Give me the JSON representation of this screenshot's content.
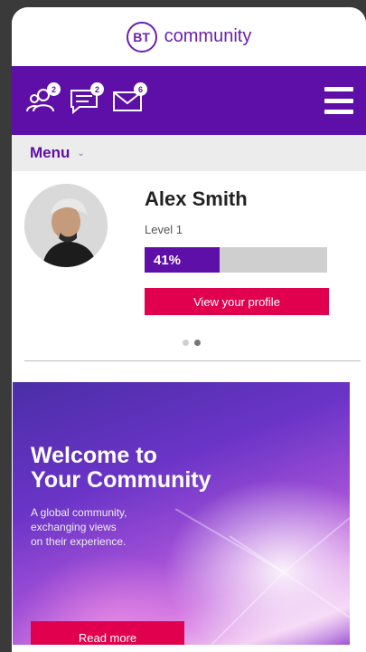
{
  "brand": {
    "logo_mark": "BT",
    "name": "community",
    "color": "#6b1fae"
  },
  "toolbar": {
    "icons": [
      {
        "name": "people-icon",
        "badge": "2"
      },
      {
        "name": "chat-icon",
        "badge": "2"
      },
      {
        "name": "mail-icon",
        "badge": "6"
      }
    ],
    "menu_icon": "hamburger-icon",
    "background": "#5e0fa8"
  },
  "menu": {
    "label": "Menu",
    "chevron": "⌄"
  },
  "profile": {
    "name": "Alex Smith",
    "level": "Level 1",
    "progress_label": "41%",
    "progress_value": 0.41,
    "view_button": "View your profile"
  },
  "carousel": {
    "dots": 2,
    "active": 1
  },
  "hero": {
    "title_line1": "Welcome to",
    "title_line2": "Your Community",
    "sub_line1": "A global community,",
    "sub_line2": "exchanging views",
    "sub_line3": "on their experience.",
    "button": "Read more"
  },
  "colors": {
    "accent": "#e0004d",
    "purple": "#5e0fa8"
  }
}
